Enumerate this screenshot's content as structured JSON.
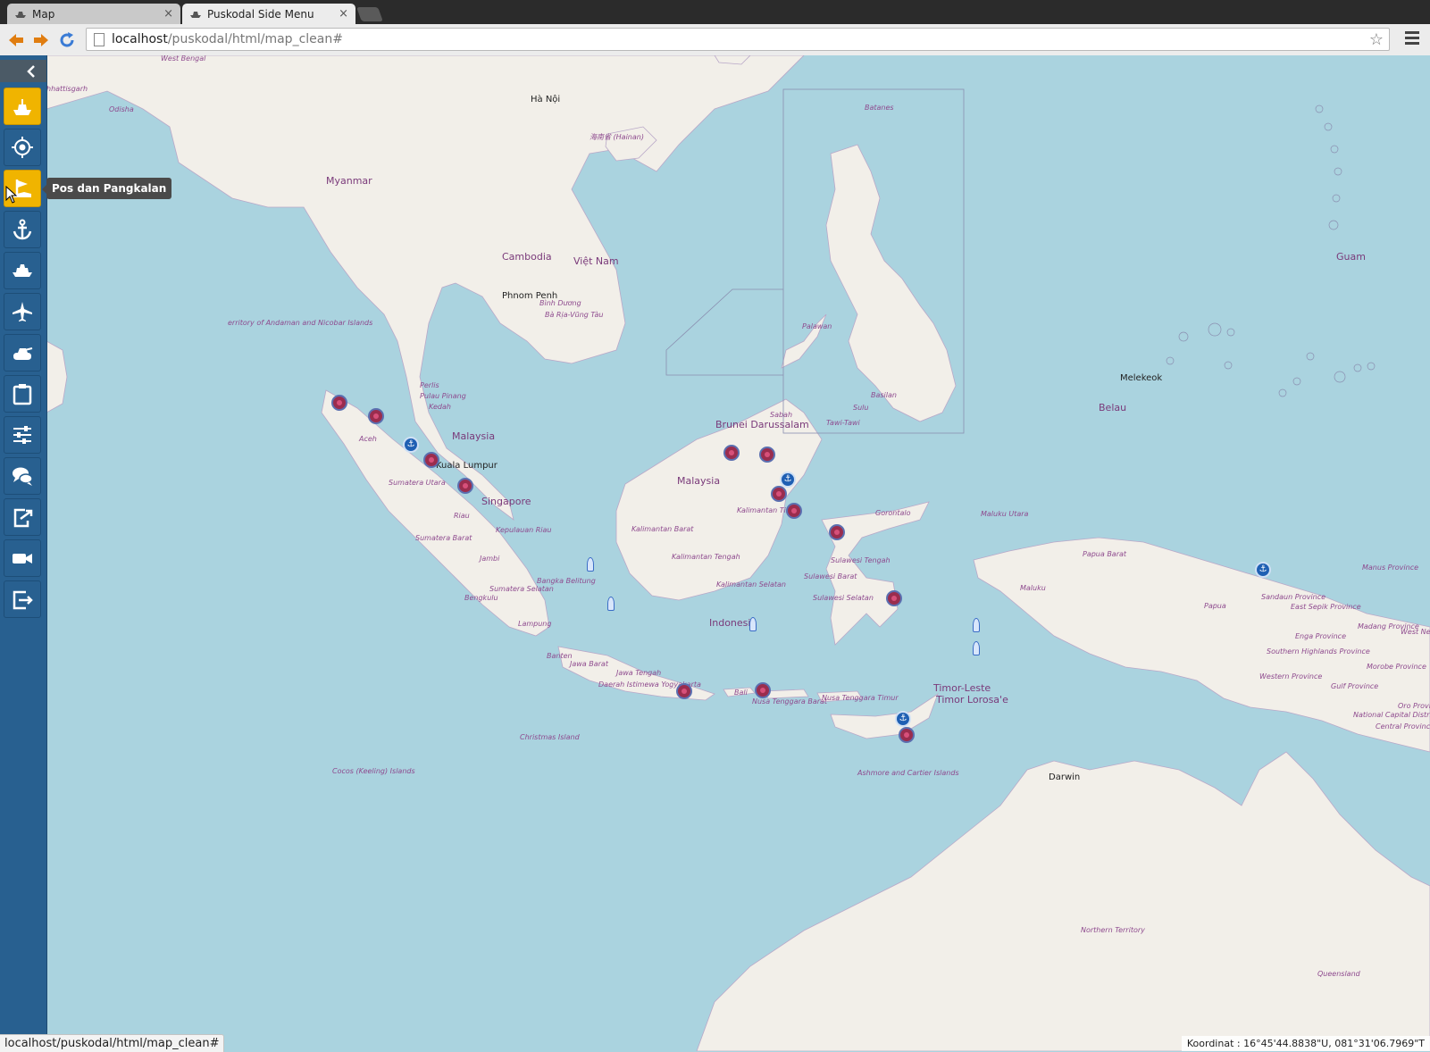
{
  "browser": {
    "tabs": [
      {
        "title": "Map",
        "active": false,
        "icon": "ship-icon"
      },
      {
        "title": "Puskodal Side Menu",
        "active": true,
        "icon": "ship-icon"
      }
    ],
    "close_glyph": "×",
    "url_host": "localhost",
    "url_path": "/puskodal/html/map_clean#",
    "star_glyph": "☆"
  },
  "sidemenu": {
    "collapse_icon": "chevron-left-icon",
    "items": [
      {
        "icon": "ship-icon",
        "active": true
      },
      {
        "icon": "target-icon",
        "active": false
      },
      {
        "icon": "flag-icon",
        "active": true
      },
      {
        "icon": "anchor-icon",
        "active": false
      },
      {
        "icon": "vessel-icon",
        "active": false
      },
      {
        "icon": "airplane-icon",
        "active": false
      },
      {
        "icon": "tank-icon",
        "active": false
      },
      {
        "icon": "clipboard-icon",
        "active": false
      },
      {
        "icon": "sliders-icon",
        "active": false
      },
      {
        "icon": "chat-icon",
        "active": false
      },
      {
        "icon": "export-icon",
        "active": false
      },
      {
        "icon": "camera-icon",
        "active": false
      },
      {
        "icon": "logout-icon",
        "active": false
      }
    ],
    "tooltip": "Pos dan Pangkalan",
    "accent_color": "#286090",
    "active_color": "#f0b400"
  },
  "map": {
    "labels": {
      "west_bengal": "West Bengal",
      "chhattisgarh": "hhattisgarh",
      "odisha": "Odisha",
      "myanmar": "Myanmar",
      "ha_noi": "Hà Nội",
      "hainan": "海南省 (Hainan)",
      "cambodia": "Cambodia",
      "viet_nam": "Việt Nam",
      "phnom_penh": "Phnom Penh",
      "binh_duong": "Bình Dương",
      "ba_ria": "Bà Rịa-Vũng Tàu",
      "andaman": "erritory of Andaman and Nicobar Islands",
      "malaysia_w": "Malaysia",
      "kuala_lumpur": "Kuala Lumpur",
      "singapore": "Singapore",
      "aceh": "Aceh",
      "sumatera_utara": "Sumatera Utara",
      "riau": "Riau",
      "kepulauan_riau": "Kepulauan Riau",
      "sumatera_barat": "Sumatera Barat",
      "jambi": "Jambi",
      "sumatera_selatan": "Sumatera Selatan",
      "bengkulu": "Bengkulu",
      "bangka_belitung": "Bangka Belitung",
      "lampung": "Lampung",
      "banten": "Banten",
      "jawa_barat": "Jawa Barat",
      "jawa_tengah": "Jawa Tengah",
      "yogyakarta": "Daerah Istimewa Yogyakarta",
      "bali": "Bali",
      "ntb": "Nusa Tenggara Barat",
      "ntt": "Nusa Tenggara Timur",
      "christmas": "Christmas Island",
      "cocos": "Cocos (Keeling) Islands",
      "brunei": "Brunei Darussalam",
      "sabah": "Sabah",
      "malaysia_e": "Malaysia",
      "kal_barat": "Kalimantan Barat",
      "kal_tengah": "Kalimantan Tengah",
      "kal_selatan": "Kalimantan Selatan",
      "kal_timur": "Kalimantan Tim",
      "indonesia": "Indonesia",
      "gorontalo": "Gorontalo",
      "sulawesi_tengah": "Sulawesi Tengah",
      "sulawesi_barat": "Sulawesi Barat",
      "sulawesi_selatan": "Sulawesi Selatan",
      "maluku_utara": "Maluku Utara",
      "maluku": "Maluku",
      "papua_barat": "Papua Barat",
      "papua": "Papua",
      "timor_leste": "Timor-Leste",
      "timor_lorosae": "Timor Lorosa'e",
      "ashmore": "Ashmore and Cartier Islands",
      "darwin": "Darwin",
      "northern_territory": "Northern Territory",
      "queensland": "Queensland",
      "melekeok": "Melekeok",
      "belau": "Belau",
      "guam": "Guam",
      "batanes": "Batanes",
      "palawan": "Palawan",
      "basilan": "Basilan",
      "sulu": "Sulu",
      "tawi_tawi": "Tawi-Tawi",
      "sandaun": "Sandaun Province",
      "east_sepik": "East Sepik Province",
      "manus": "Manus Province",
      "madang": "Madang Province",
      "enga": "Enga Province",
      "southern_highlands": "Southern Highlands Province",
      "western_province": "Western Province",
      "gulf_province": "Gulf Province",
      "morobe": "Morobe Province",
      "ncd": "National Capital District",
      "central_province": "Central Province",
      "oro": "Oro Province",
      "west_new": "West Ne",
      "pulau_pinang": "Pulau Pinang",
      "kedah": "Kedah",
      "perlis": "Perlis"
    },
    "land_color": "#f2efe9",
    "water_color": "#aad3df"
  },
  "status": {
    "url": "localhost/puskodal/html/map_clean#",
    "coordinates": "Koordinat : 16°45'44.8838\"U, 081°31'06.7969\"T"
  }
}
